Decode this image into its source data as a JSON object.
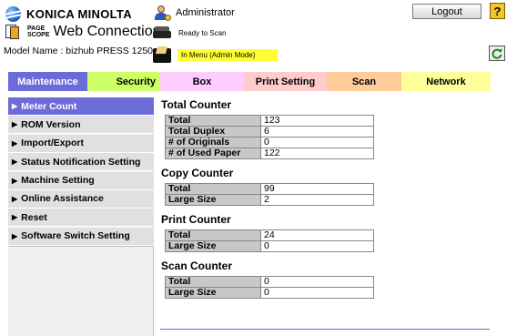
{
  "header": {
    "brand": "KONICA MINOLTA",
    "product_small_top": "PAGE",
    "product_small_bottom": "SCOPE",
    "product": "Web Connection",
    "model": "Model Name : bizhub PRESS 1250",
    "user": "Administrator",
    "logout_label": "Logout",
    "help_label": "?",
    "status_ready": "Ready to Scan",
    "status_mode": "In Menu (Admin Mode)",
    "colors": {
      "status_badge": "#ffff33",
      "help": "#f2c62a"
    }
  },
  "tabs": [
    {
      "label": "Maintenance",
      "color": "#6b6bd9",
      "active": true
    },
    {
      "label": "Security",
      "color": "#ccff66"
    },
    {
      "label": "Box",
      "color": "#ffccff"
    },
    {
      "label": "Print Setting",
      "color": "#ffcccc"
    },
    {
      "label": "Scan",
      "color": "#ffcc99"
    },
    {
      "label": "Network",
      "color": "#ffff99"
    }
  ],
  "sidebar": {
    "items": [
      {
        "label": "Meter Count",
        "active": true
      },
      {
        "label": "ROM Version"
      },
      {
        "label": "Import/Export"
      },
      {
        "label": "Status Notification Setting"
      },
      {
        "label": "Machine Setting"
      },
      {
        "label": "Online Assistance"
      },
      {
        "label": "Reset"
      },
      {
        "label": "Software Switch Setting"
      }
    ]
  },
  "main": {
    "total_counter": {
      "title": "Total Counter",
      "rows": [
        {
          "label": "Total",
          "value": "123"
        },
        {
          "label": "Total Duplex",
          "value": "6"
        },
        {
          "label": "# of Originals",
          "value": "0"
        },
        {
          "label": "# of Used Paper",
          "value": "122"
        }
      ]
    },
    "copy_counter": {
      "title": "Copy Counter",
      "rows": [
        {
          "label": "Total",
          "value": "99"
        },
        {
          "label": "Large Size",
          "value": "2"
        }
      ]
    },
    "print_counter": {
      "title": "Print Counter",
      "rows": [
        {
          "label": "Total",
          "value": "24"
        },
        {
          "label": "Large Size",
          "value": "0"
        }
      ]
    },
    "scan_counter": {
      "title": "Scan Counter",
      "rows": [
        {
          "label": "Total",
          "value": "0"
        },
        {
          "label": "Large Size",
          "value": "0"
        }
      ]
    }
  }
}
